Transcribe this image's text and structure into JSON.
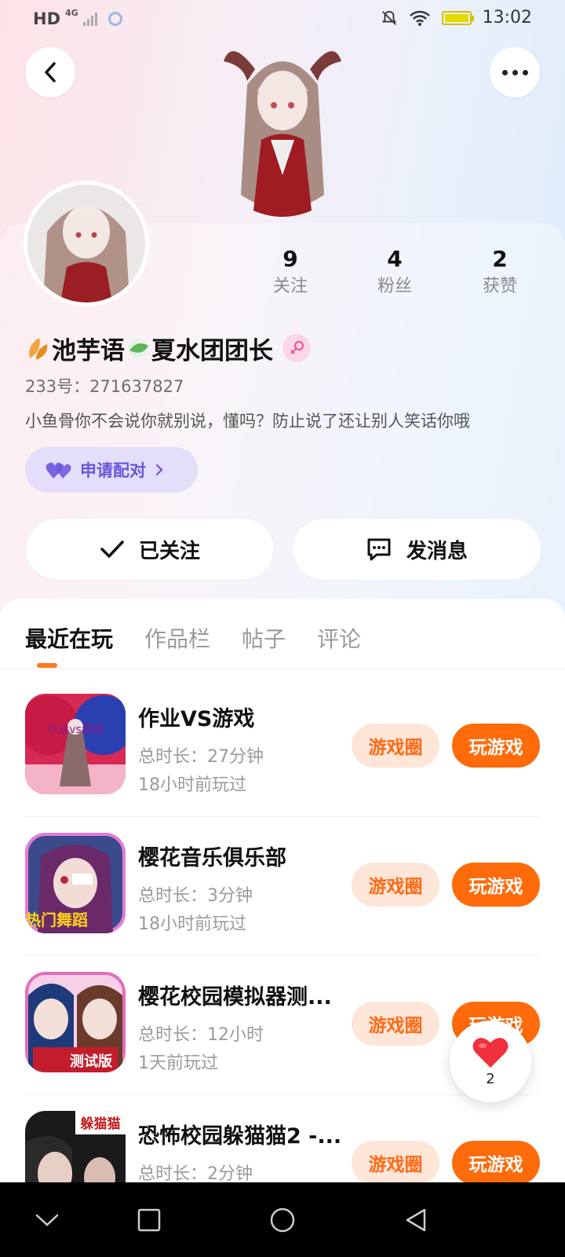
{
  "status_bar": {
    "network_label": "HD",
    "network_type": "4G",
    "time": "13:02"
  },
  "profile": {
    "name": "池芋语",
    "name_suffix": "夏水团团长",
    "uid": "233号：271637827",
    "bio": "小鱼骨你不会说你就别说，懂吗？防止说了还让别人笑话你哦",
    "stats": [
      {
        "value": "9",
        "label": "关注"
      },
      {
        "value": "4",
        "label": "粉丝"
      },
      {
        "value": "2",
        "label": "获赞"
      }
    ],
    "pair_button_label": "申请配对",
    "follow_button_label": "已关注",
    "message_button_label": "发消息"
  },
  "tabs": [
    {
      "label": "最近在玩",
      "active": true
    },
    {
      "label": "作品栏",
      "active": false
    },
    {
      "label": "帖子",
      "active": false
    },
    {
      "label": "评论",
      "active": false
    }
  ],
  "games": [
    {
      "title": "作业VS游戏",
      "duration": "总时长：27分钟",
      "last_played": "18小时前玩过",
      "icon_text": "作业vs游戏",
      "circle_label": "游戏圈",
      "play_label": "玩游戏"
    },
    {
      "title": "樱花音乐俱乐部",
      "duration": "总时长：3分钟",
      "last_played": "18小时前玩过",
      "icon_text": "热门舞蹈",
      "circle_label": "游戏圈",
      "play_label": "玩游戏"
    },
    {
      "title": "樱花校园模拟器测...",
      "duration": "总时长：12小时",
      "last_played": "1天前玩过",
      "icon_text": "测试版",
      "circle_label": "游戏圈",
      "play_label": "玩游戏"
    },
    {
      "title": "恐怖校园躲猫猫2 -...",
      "duration": "总时长：2分钟",
      "last_played": "",
      "icon_text": "躲猫猫",
      "circle_label": "游戏圈",
      "play_label": "玩游戏"
    }
  ],
  "like_fab": {
    "count": "2"
  },
  "colors": {
    "accent_orange": "#ff6a0a",
    "pair_purple": "#6a55d9",
    "heart_red": "#f0303c"
  }
}
